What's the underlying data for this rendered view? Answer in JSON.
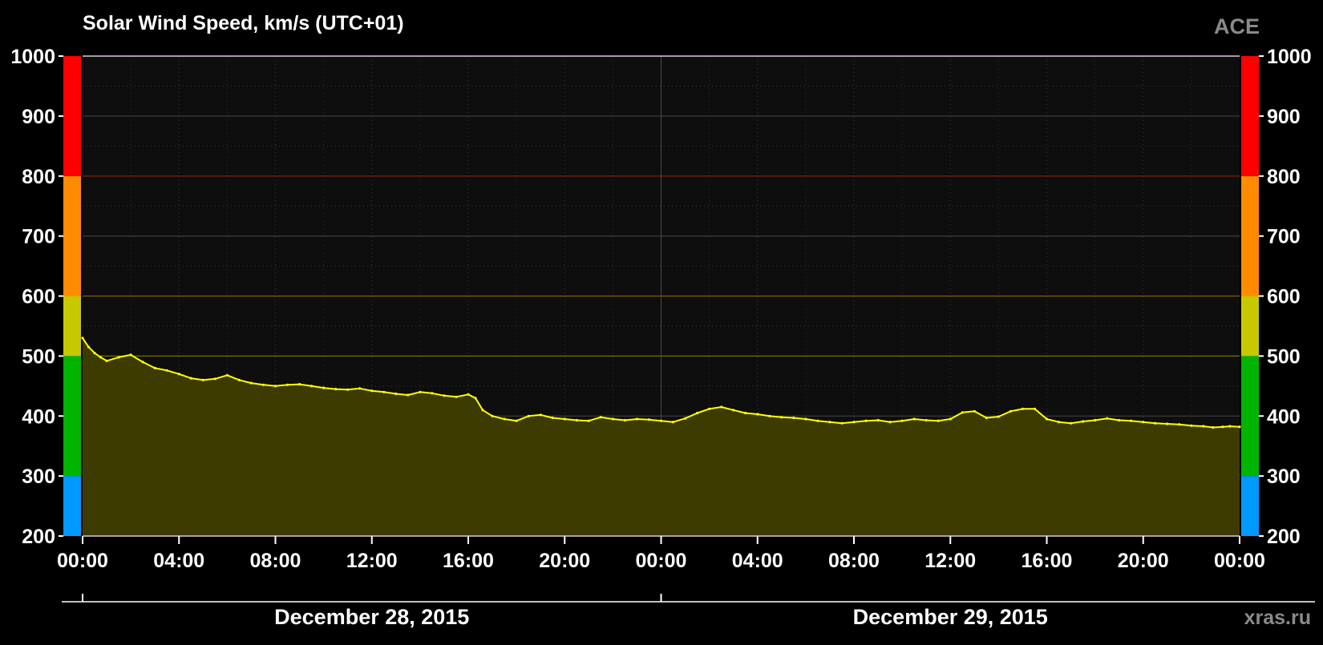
{
  "chart_data": {
    "type": "area",
    "title": "Solar Wind Speed, km/s (UTC+01)",
    "source_label": "ACE",
    "watermark": "xras.ru",
    "x_tick_labels": [
      "00:00",
      "04:00",
      "08:00",
      "12:00",
      "16:00",
      "20:00",
      "00:00",
      "04:00",
      "08:00",
      "12:00",
      "16:00",
      "20:00",
      "00:00"
    ],
    "date_labels": [
      "December 28, 2015",
      "December 29, 2015"
    ],
    "x_range_hours": [
      0,
      48
    ],
    "ylim": [
      200,
      1000
    ],
    "y_ticks": [
      200,
      300,
      400,
      500,
      600,
      700,
      800,
      900,
      1000
    ],
    "grid": true,
    "scale_bands": [
      {
        "from": 200,
        "to": 300,
        "color": "#0099ff"
      },
      {
        "from": 300,
        "to": 500,
        "color": "#00b400"
      },
      {
        "from": 500,
        "to": 600,
        "color": "#c8c800"
      },
      {
        "from": 600,
        "to": 800,
        "color": "#ff8c00"
      },
      {
        "from": 800,
        "to": 1000,
        "color": "#ff0000"
      }
    ],
    "series": [
      {
        "color": "#ffff00",
        "fill_color": "#3d3b00",
        "x_hours": [
          0.0,
          0.25,
          0.5,
          0.75,
          1.0,
          1.5,
          2.0,
          2.5,
          3.0,
          3.5,
          4.0,
          4.5,
          5.0,
          5.5,
          6.0,
          6.5,
          7.0,
          7.5,
          8.0,
          8.5,
          9.0,
          9.5,
          10.0,
          10.5,
          11.0,
          11.5,
          12.0,
          12.5,
          13.0,
          13.5,
          14.0,
          14.5,
          15.0,
          15.5,
          16.0,
          16.3,
          16.6,
          17.0,
          17.5,
          18.0,
          18.5,
          19.0,
          19.5,
          20.0,
          20.5,
          21.0,
          21.5,
          22.0,
          22.5,
          23.0,
          23.5,
          24.0,
          24.5,
          25.0,
          25.5,
          26.0,
          26.5,
          27.0,
          27.5,
          28.0,
          28.5,
          29.0,
          29.5,
          30.0,
          30.5,
          31.0,
          31.5,
          32.0,
          32.5,
          33.0,
          33.5,
          34.0,
          34.5,
          35.0,
          35.5,
          36.0,
          36.5,
          37.0,
          37.5,
          38.0,
          38.5,
          39.0,
          39.5,
          40.0,
          40.5,
          41.0,
          41.5,
          42.0,
          42.5,
          43.0,
          43.5,
          44.0,
          44.5,
          45.0,
          45.5,
          46.0,
          46.5,
          46.9,
          47.3,
          47.6,
          48.0
        ],
        "values": [
          530,
          515,
          505,
          498,
          492,
          498,
          502,
          490,
          480,
          476,
          470,
          463,
          460,
          462,
          468,
          460,
          455,
          452,
          450,
          452,
          453,
          450,
          447,
          445,
          444,
          446,
          442,
          440,
          437,
          435,
          440,
          438,
          434,
          432,
          436,
          430,
          410,
          400,
          395,
          392,
          400,
          402,
          397,
          395,
          393,
          392,
          398,
          395,
          393,
          395,
          394,
          392,
          390,
          396,
          405,
          412,
          415,
          410,
          405,
          403,
          400,
          398,
          397,
          395,
          392,
          390,
          388,
          390,
          392,
          393,
          390,
          392,
          395,
          393,
          392,
          395,
          406,
          408,
          397,
          399,
          408,
          412,
          412,
          395,
          390,
          388,
          391,
          393,
          396,
          393,
          392,
          390,
          388,
          387,
          386,
          384,
          383,
          381,
          382,
          383,
          382
        ]
      }
    ],
    "annotations": []
  }
}
